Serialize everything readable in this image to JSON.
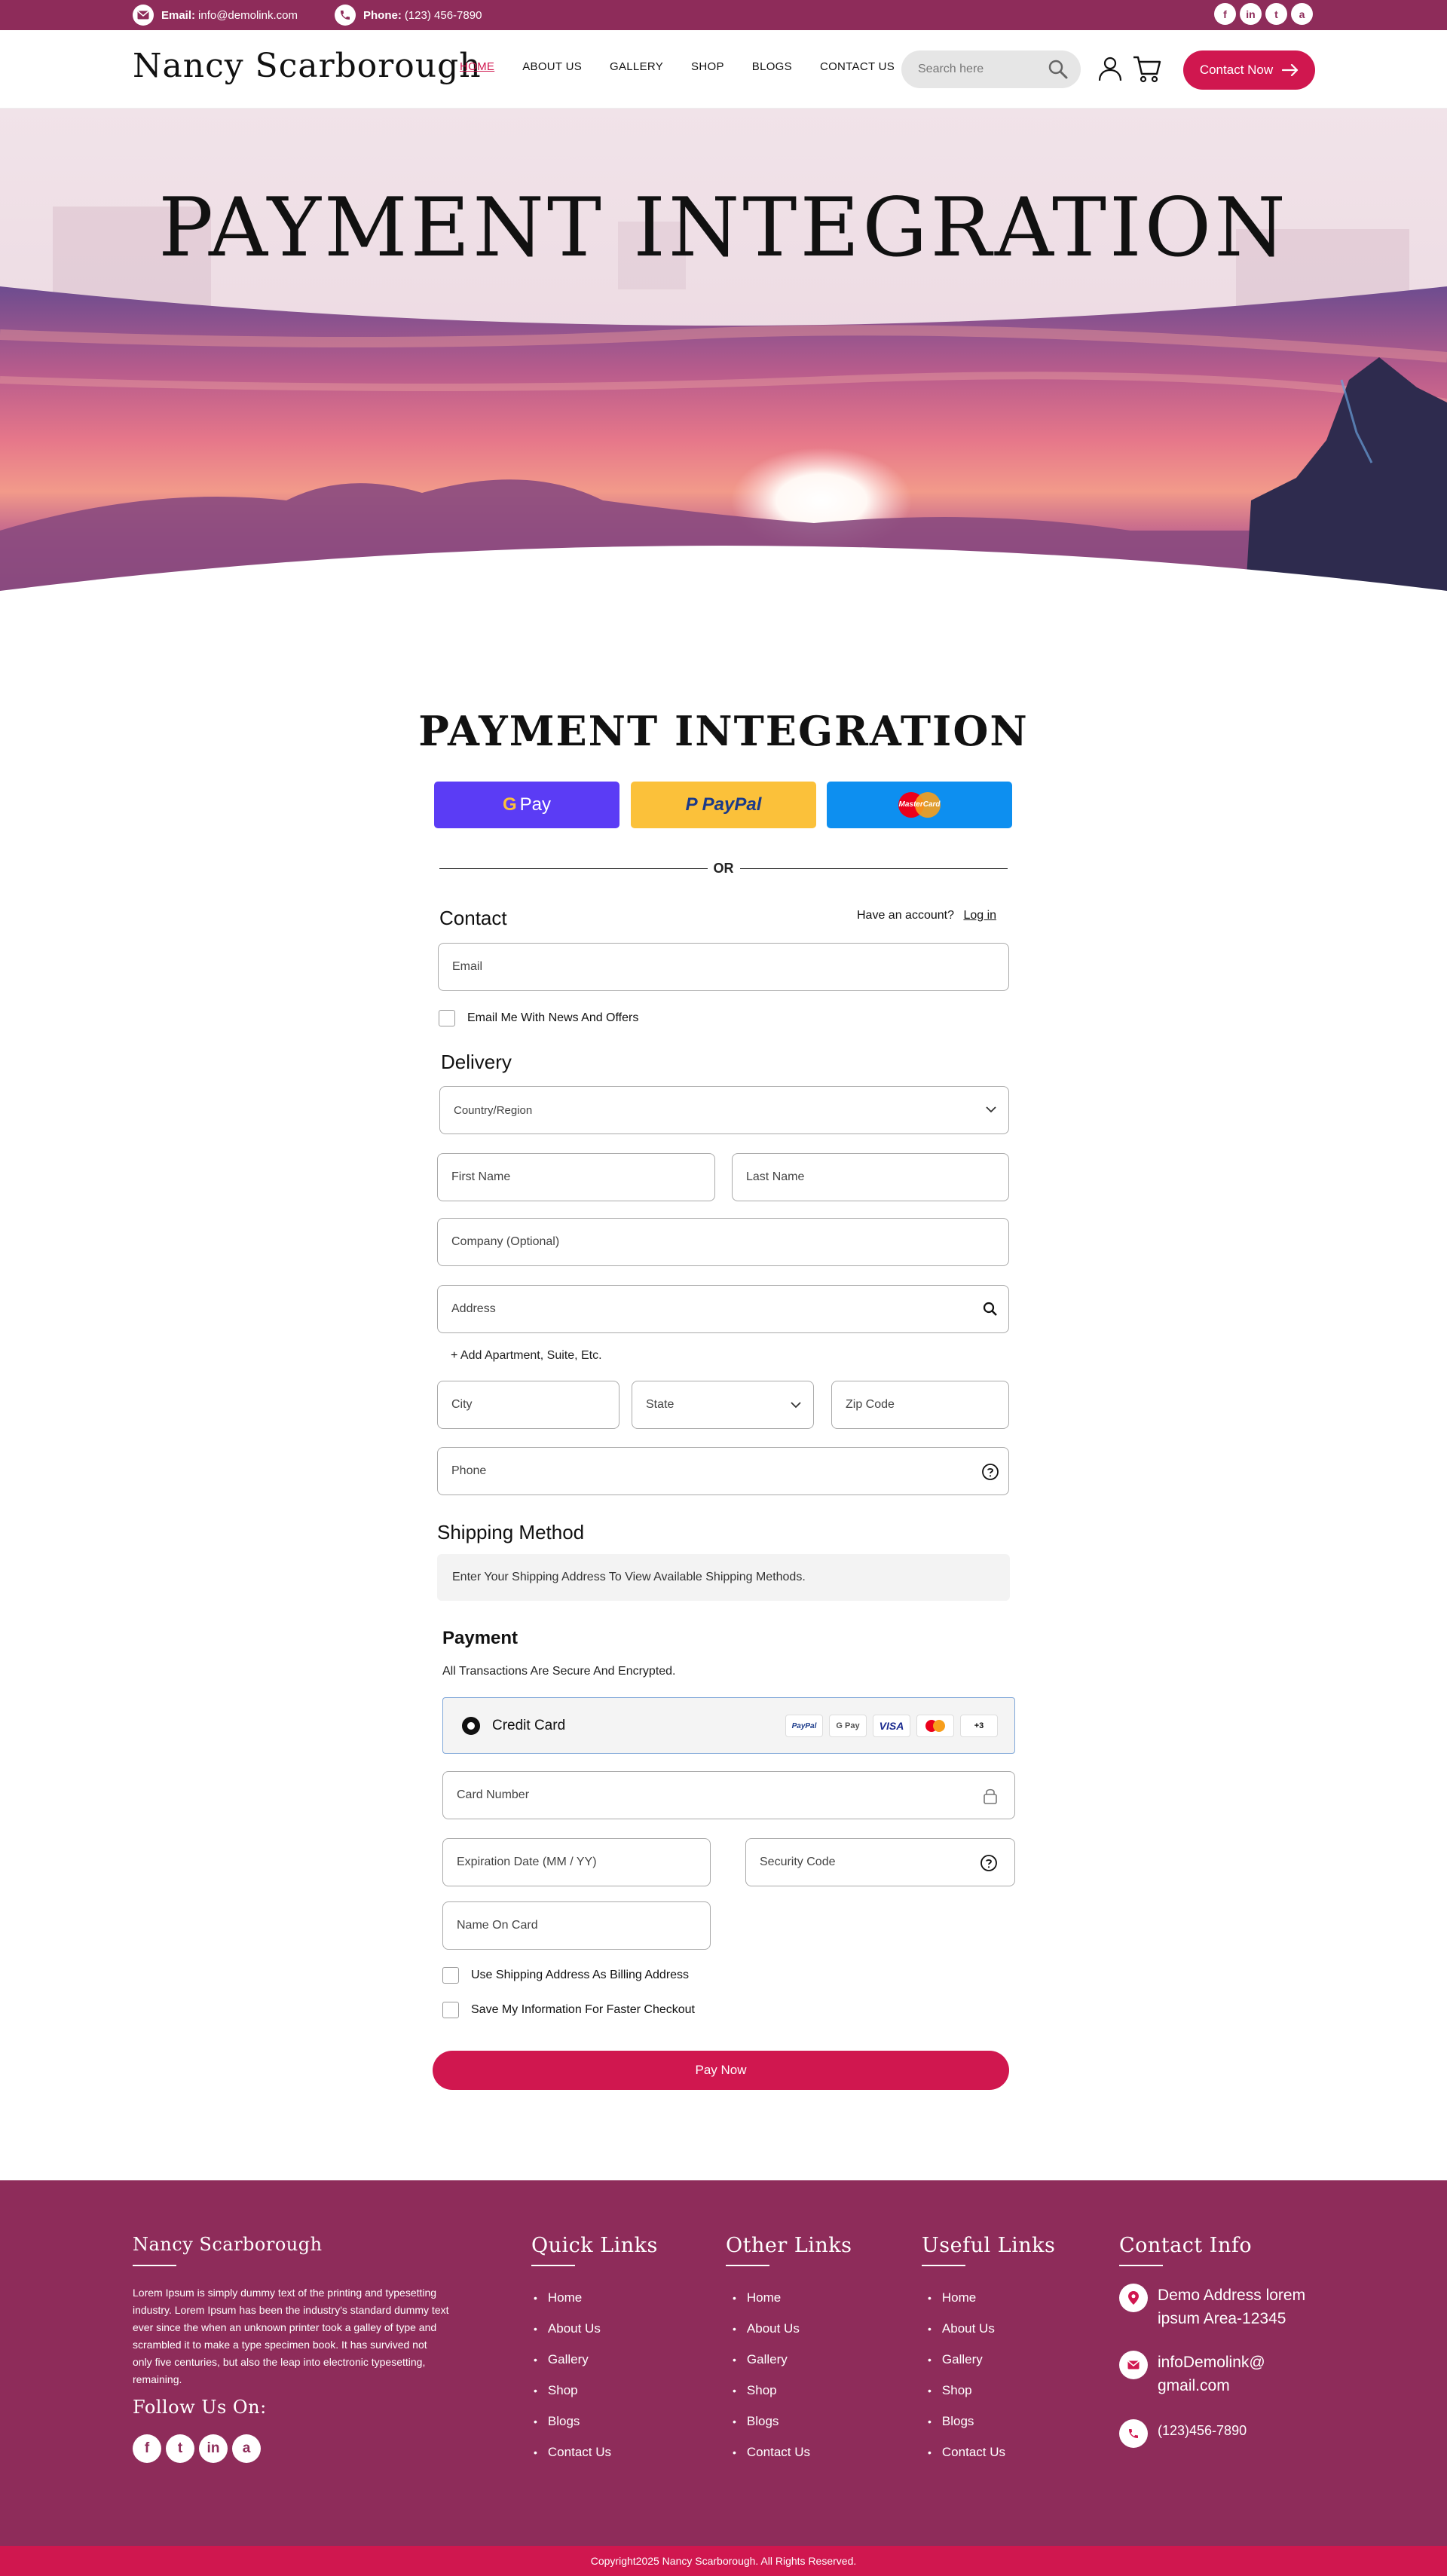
{
  "topbar": {
    "email_label": "Email:",
    "email_value": "info@demolink.com",
    "phone_label": "Phone:",
    "phone_value": "(123) 456-7890",
    "social": [
      "f",
      "in",
      "t",
      "a"
    ]
  },
  "header": {
    "logo": "Nancy Scarborough",
    "nav": [
      "HOME",
      "ABOUT US",
      "GALLERY",
      "SHOP",
      "BLOGS",
      "CONTACT US"
    ],
    "active_nav": "HOME",
    "search_placeholder": "Search here",
    "contact_button": "Contact Now"
  },
  "hero": {
    "title": "PAYMENT INTEGRATION"
  },
  "checkout": {
    "title": "PAYMENT INTEGRATION",
    "gpay_label": "Pay",
    "paypal_label": "PayPal",
    "mastercard_label": "MasterCard",
    "or_label": "OR",
    "contact_heading": "Contact",
    "have_account": "Have an account?",
    "login_label": "Log in",
    "email_placeholder": "Email",
    "email_news": "Email Me With News And Offers",
    "delivery_heading": "Delivery",
    "country_placeholder": "Country/Region",
    "first_name": "First Name",
    "last_name": "Last Name",
    "company": "Company (Optional)",
    "address": "Address",
    "add_apartment": "+  Add Apartment, Suite, Etc.",
    "city": "City",
    "state": "State",
    "zip": "Zip Code",
    "phone": "Phone",
    "shipping_heading": "Shipping Method",
    "shipping_note": "Enter Your Shipping Address To View Available Shipping Methods.",
    "payment_heading": "Payment",
    "payment_note": "All Transactions Are Secure And Encrypted.",
    "credit_card_label": "Credit Card",
    "card_logos": [
      "PayPal",
      "G Pay",
      "VISA",
      "MC",
      "+3"
    ],
    "card_number": "Card Number",
    "expiration": "Expiration Date (MM / YY)",
    "security_code": "Security Code",
    "name_on_card": "Name On Card",
    "use_shipping": "Use Shipping Address As Billing Address",
    "save_info": "Save My Information For Faster Checkout",
    "pay_now": "Pay Now"
  },
  "footer": {
    "brand": "Nancy Scarborough",
    "description": "Lorem Ipsum is simply dummy text of the printing and typesetting industry. Lorem Ipsum has been the industry's standard dummy text ever since the  when an unknown printer took a galley of type and scrambled it to make a type specimen book. It has survived not only five centuries, but also the leap into electronic typesetting, remaining.",
    "follow": "Follow Us On:",
    "social": [
      "f",
      "t",
      "in",
      "a"
    ],
    "quick_links_title": "Quick Links",
    "quick_links": [
      "Home",
      "About Us",
      "Gallery",
      "Shop",
      "Blogs",
      "Contact Us"
    ],
    "other_links_title": "Other Links",
    "other_links": [
      "Home",
      "About Us",
      "Gallery",
      "Shop",
      "Blogs",
      "Contact Us"
    ],
    "useful_links_title": "Useful Links",
    "useful_links": [
      "Home",
      "About Us",
      "Gallery",
      "Shop",
      "Blogs",
      "Contact Us"
    ],
    "contact_info_title": "Contact Info",
    "address_line1": "Demo Address  lorem",
    "address_line2": "ipsum Area-12345",
    "email_line1": "infoDemolink@",
    "email_line2": "gmail.com",
    "phone": "(123)456-7890"
  },
  "copyright": "Copyright2025 Nancy Scarborough. All Rights Reserved.",
  "colors": {
    "primary": "#8e2c5a",
    "accent": "#d0174f",
    "gpay": "#5b3cf5",
    "paypal": "#fbc13a",
    "mastercard": "#0d8ff0"
  }
}
